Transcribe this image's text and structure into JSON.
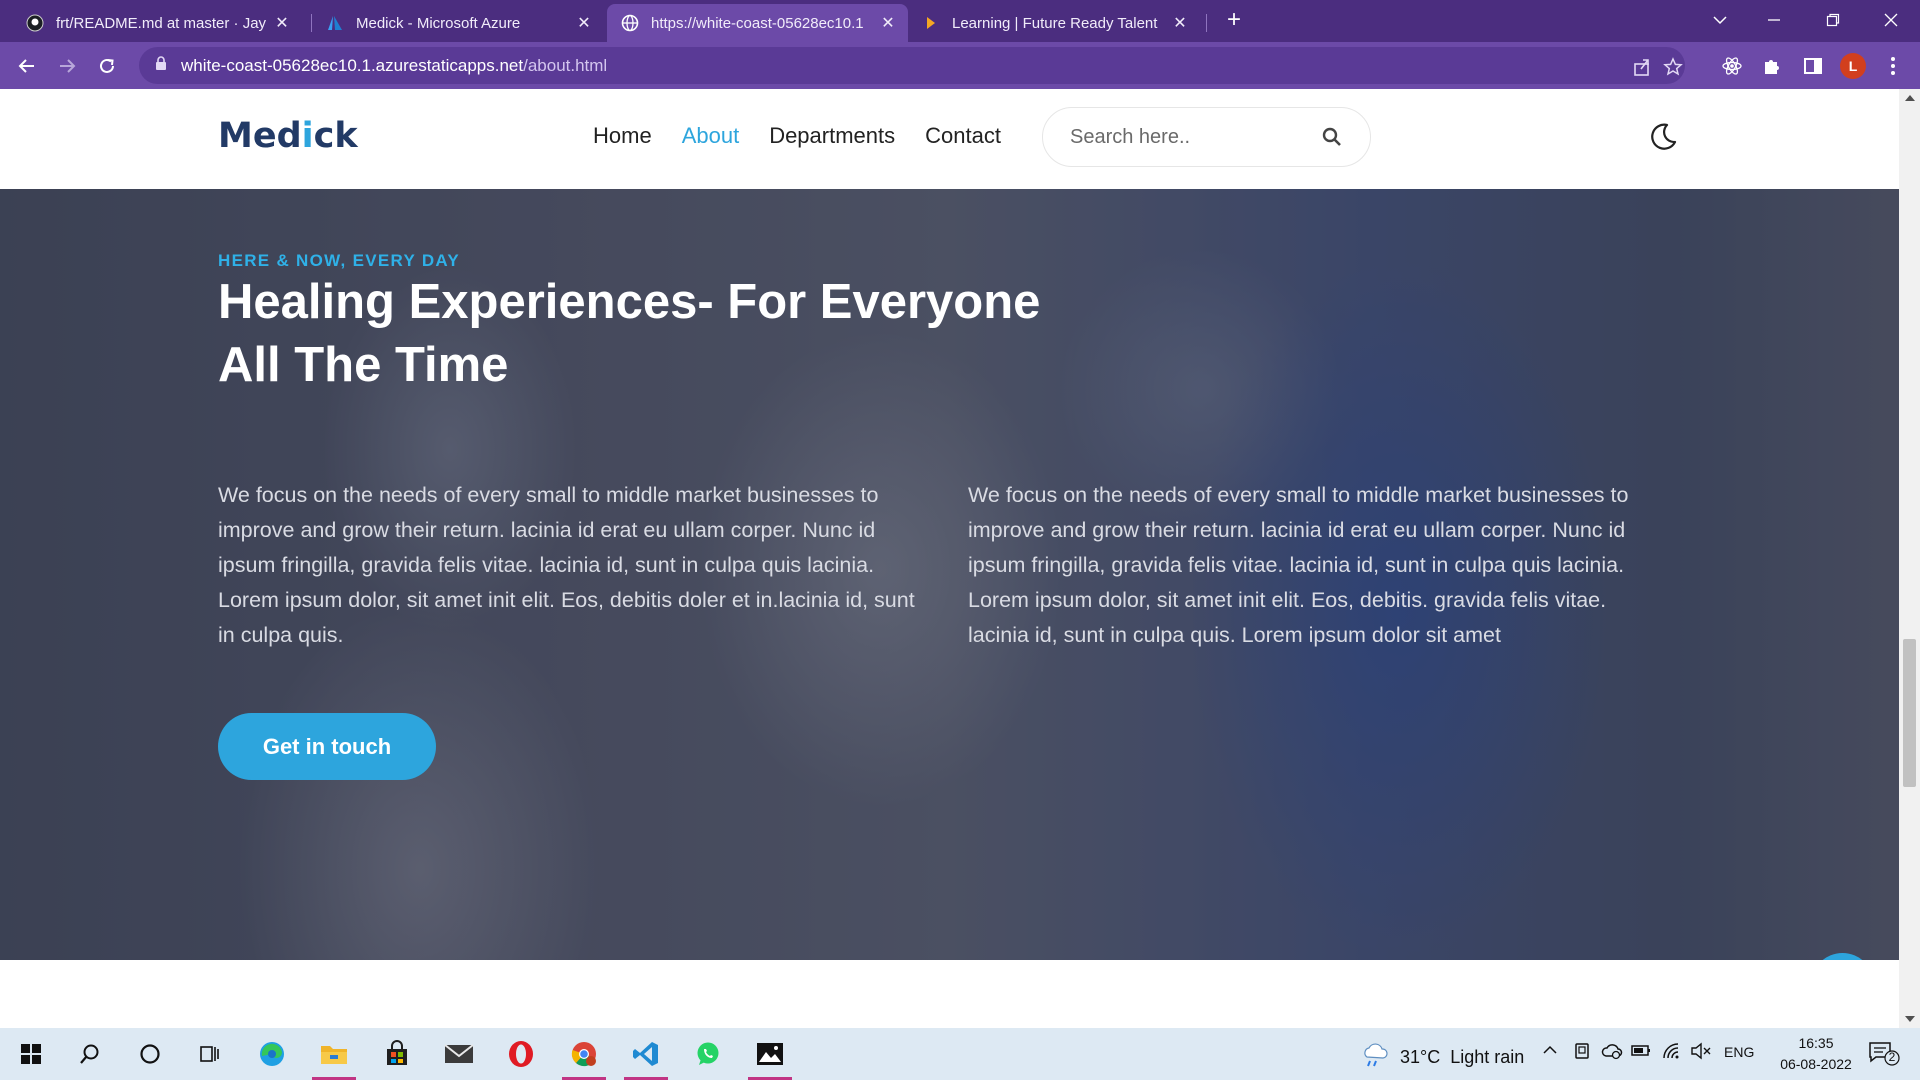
{
  "browser": {
    "tabs": [
      {
        "title": "frt/README.md at master · Jayala",
        "icon": "github-icon"
      },
      {
        "title": "Medick - Microsoft Azure",
        "icon": "azure-icon"
      },
      {
        "title": "https://white-coast-05628ec10.1",
        "icon": "globe-icon"
      },
      {
        "title": "Learning | Future Ready Talent",
        "icon": "learning-icon"
      }
    ],
    "url_host": "white-coast-05628ec10.1.azurestaticapps.net",
    "url_path": "/about.html",
    "profile_initial": "L"
  },
  "site": {
    "logo_main": "Med",
    "logo_accent": "i",
    "logo_end": "ck",
    "nav": {
      "home": "Home",
      "about": "About",
      "departments": "Departments",
      "contact": "Contact"
    },
    "search_placeholder": "Search here..",
    "hero": {
      "eyebrow": "HERE & NOW, EVERY DAY",
      "headline": "Healing Experiences- For Everyone All The Time",
      "para1": "We focus on the needs of every small to middle market businesses to improve and grow their return. lacinia id erat eu ullam corper. Nunc id ipsum fringilla, gravida felis vitae. lacinia id, sunt in culpa quis lacinia. Lorem ipsum dolor, sit amet init elit. Eos, debitis doler et in.lacinia id, sunt in culpa quis.",
      "para2": "We focus on the needs of every small to middle market businesses to improve and grow their return. lacinia id erat eu ullam corper. Nunc id ipsum fringilla, gravida felis vitae. lacinia id, sunt in culpa quis lacinia. Lorem ipsum dolor, sit amet init elit. Eos, debitis. gravida felis vitae. lacinia id, sunt in culpa quis. Lorem ipsum dolor sit amet",
      "cta": "Get in touch"
    },
    "accent_color": "#2da5dd",
    "brand_color": "#223a66"
  },
  "taskbar": {
    "weather_temp": "31°C",
    "weather_desc": "Light rain",
    "language": "ENG",
    "time": "16:35",
    "date": "06-08-2022",
    "notification_count": "2"
  }
}
